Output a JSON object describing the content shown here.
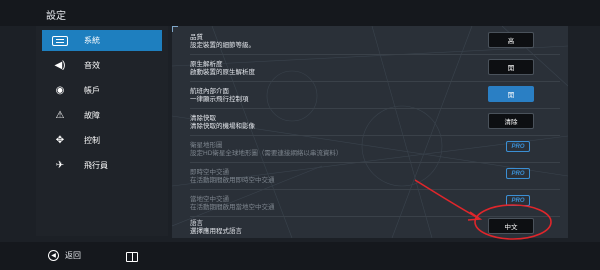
{
  "header": {
    "title": "設定"
  },
  "sidebar": {
    "items": [
      {
        "label": "系統",
        "icon": "system-icon",
        "active": true
      },
      {
        "label": "音效",
        "icon": "speaker-icon"
      },
      {
        "label": "帳戶",
        "icon": "account-icon"
      },
      {
        "label": "故障",
        "icon": "warning-icon"
      },
      {
        "label": "控制",
        "icon": "gamepad-icon"
      },
      {
        "label": "飛行員",
        "icon": "pilot-icon"
      }
    ]
  },
  "settings": [
    {
      "title": "品質",
      "desc": "設定裝置的細節等級。",
      "value": "高"
    },
    {
      "title": "原生解析度",
      "desc": "啟動裝置的原生解析度",
      "value": "開"
    },
    {
      "title": "航班內部介面",
      "desc": "一律顯示飛行控制項",
      "value": "開"
    },
    {
      "title": "清除快取",
      "desc": "清除快取的機場和影像",
      "value": "清除"
    },
    {
      "title": "衛星地形圖",
      "desc": "設定HD衛星全球地形圖（需要連接網絡以串流資料）",
      "value": "PRO"
    },
    {
      "title": "即時空中交通",
      "desc": "在活動期間啟用即時空中交通",
      "value": "PRO"
    },
    {
      "title": "當地空中交通",
      "desc": "在活動期間啟用當地空中交通",
      "value": "PRO"
    },
    {
      "title": "語言",
      "desc": "選擇應用程式語言",
      "value": "中文"
    }
  ],
  "footer": {
    "back_label": "返回"
  },
  "colors": {
    "accent": "#1e7fbf",
    "annotation": "#e0262b"
  }
}
